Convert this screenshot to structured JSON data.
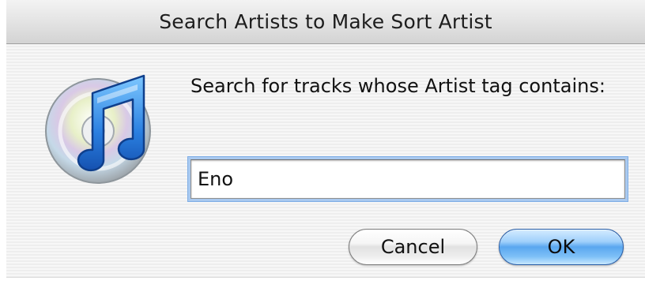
{
  "window": {
    "title": "Search Artists to Make Sort Artist"
  },
  "dialog": {
    "icon": "itunes-icon",
    "prompt": "Search for tracks whose Artist tag contains:",
    "input_value": "Eno",
    "focus_ring_color": "#7faee6"
  },
  "buttons": {
    "cancel_label": "Cancel",
    "ok_label": "OK",
    "default_color": "#5aa7ef"
  }
}
